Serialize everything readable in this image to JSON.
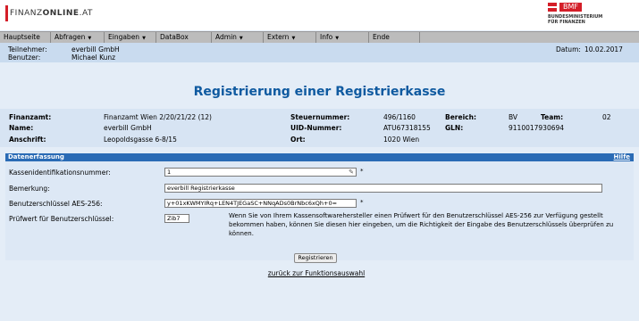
{
  "header": {
    "logo_plain": "FINANZ",
    "logo_bold": "ONLINE",
    "logo_suffix": ".AT",
    "bmf_label": "BMF",
    "bmf_sub1": "BUNDESMINISTERIUM",
    "bmf_sub2": "FÜR FINANZEN"
  },
  "menu": [
    {
      "label": "Hauptseite",
      "dropdown": false
    },
    {
      "label": "Abfragen",
      "dropdown": true
    },
    {
      "label": "Eingaben",
      "dropdown": true
    },
    {
      "label": "DataBox",
      "dropdown": false
    },
    {
      "label": "Admin",
      "dropdown": true
    },
    {
      "label": "Extern",
      "dropdown": true
    },
    {
      "label": "Info",
      "dropdown": true
    },
    {
      "label": "Ende",
      "dropdown": false
    }
  ],
  "info": {
    "teilnehmer_label": "Teilnehmer:",
    "teilnehmer": "everbill GmbH",
    "benutzer_label": "Benutzer:",
    "benutzer": "Michael Kunz",
    "datum_label": "Datum:",
    "datum": "10.02.2017"
  },
  "title": "Registrierung einer Registrierkasse",
  "details": {
    "finanzamt_label": "Finanzamt:",
    "finanzamt": "Finanzamt Wien 2/20/21/22 (12)",
    "steuernummer_label": "Steuernummer:",
    "steuernummer": "496/1160",
    "bereich_label": "Bereich:",
    "bereich": "BV",
    "team_label": "Team:",
    "team": "02",
    "name_label": "Name:",
    "name": "everbill GmbH",
    "uid_label": "UID-Nummer:",
    "uid": "ATU67318155",
    "gln_label": "GLN:",
    "gln": "9110017930694",
    "anschrift_label": "Anschrift:",
    "anschrift": "Leopoldsgasse 6-8/15",
    "ort_label": "Ort:",
    "ort": "1020 Wien"
  },
  "form": {
    "section_title": "Datenerfassung",
    "hilfe": "Hilfe",
    "kassen_label": "Kassenidentifikationsnummer:",
    "kassen_value": "1",
    "bemerkung_label": "Bemerkung:",
    "bemerkung_value": "everbill Registrierkasse",
    "aes_label": "Benutzerschlüssel AES-256:",
    "aes_value": "y+01xKWMYIRq+LEN4TJEGaSC+NNqADs0BrNbc6xQh+0=",
    "pruef_label": "Prüfwert für Benutzerschlüssel:",
    "pruef_value": "Zib7",
    "required_mark": "*",
    "help_text": "Wenn Sie von Ihrem Kassensoftwarehersteller einen Prüfwert für den Benutzerschlüssel AES-256 zur Verfügung gestellt bekommen haben, können Sie diesen hier eingeben, um die Richtigkeit der Eingabe des Benutzerschlüssels überprüfen zu können."
  },
  "actions": {
    "register_label": "Registrieren",
    "back_label": "zurück zur Funktionsauswahl"
  },
  "colors": {
    "title": "#0f5aa0",
    "section_header": "#2a6bb5",
    "brand_red": "#d41e28"
  },
  "icons": {
    "kassen_field_icon": "pencil-icon"
  }
}
